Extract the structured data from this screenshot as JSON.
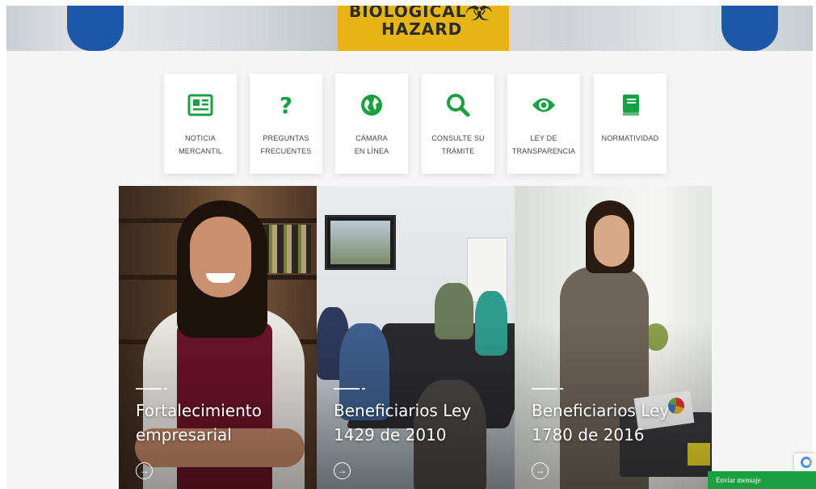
{
  "hero": {
    "sign_text_line1": "BIOLOGICAL",
    "sign_text_line2": "HAZARD",
    "sign_symbol": "biohazard-symbol"
  },
  "shortcuts": [
    {
      "line1": "NOTICIA",
      "line2": "MERCANTIL",
      "icon": "newspaper-icon"
    },
    {
      "line1": "PREGUNTAS",
      "line2": "FRECUENTES",
      "icon": "question-mark-icon"
    },
    {
      "line1": "CÁMARA",
      "line2": "EN LÍNEA",
      "icon": "globe-icon"
    },
    {
      "line1": "CONSULTE SU",
      "line2": "TRÁMITE",
      "icon": "search-icon"
    },
    {
      "line1": "LEY DE",
      "line2": "TRANSPARENCIA",
      "icon": "eye-icon"
    },
    {
      "line1": "",
      "line2": "NORMATIVIDAD",
      "icon": "book-icon"
    }
  ],
  "cards": [
    {
      "title_line1": "Fortalecimiento",
      "title_line2": "empresarial",
      "arrow": "→"
    },
    {
      "title_line1": "Beneficiarios Ley",
      "title_line2": "1429 de 2010",
      "arrow": "→"
    },
    {
      "title_line1": "Beneficiarios Ley",
      "title_line2": "1780 de 2016",
      "arrow": "→"
    }
  ],
  "chat": {
    "label": "Enviar mensaje"
  },
  "colors": {
    "accent_green": "#1aa043",
    "page_bg": "#f4f5f4"
  }
}
